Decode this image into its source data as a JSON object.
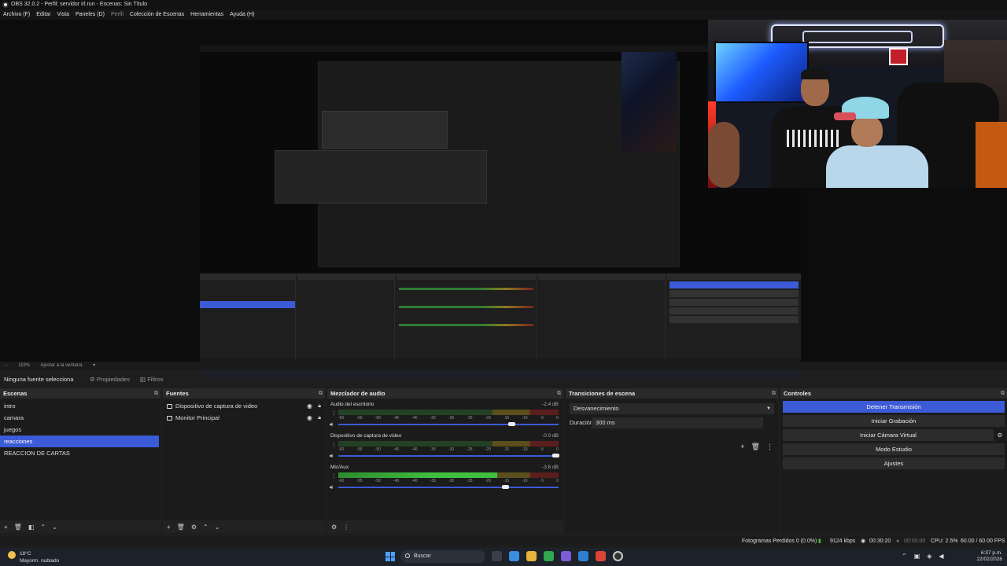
{
  "window": {
    "title": "OBS 32.0.2 - Perfil: servidor irl.run - Escenas: Sin Título"
  },
  "menu": [
    "Archivo (F)",
    "Editar",
    "Vista",
    "Paneles (D)",
    "Perfil",
    "Colección de Escenas",
    "Herramientas",
    "Ayuda (H)"
  ],
  "menu_dim_index": 4,
  "preview": {
    "zoom": "119%",
    "fit_label": "Ajustar a la ventana"
  },
  "propbar": {
    "no_source": "Ninguna fuente selecciona",
    "properties": "Propiedades",
    "filters": "Filtros"
  },
  "scenes": {
    "title": "Escenas",
    "items": [
      "intro",
      "camara",
      "juegos",
      "reacciones",
      "REACCION DE CARTAS"
    ],
    "selected_index": 3
  },
  "sources": {
    "title": "Fuentes",
    "items": [
      "Dispositivo de captura de video",
      "Monitor Principal"
    ]
  },
  "mixer": {
    "title": "Mezclador de audio",
    "ticks": [
      "-60",
      "-55",
      "-50",
      "-45",
      "-40",
      "-35",
      "-30",
      "-25",
      "-20",
      "-15",
      "-10",
      "-5",
      "0"
    ],
    "channels": [
      {
        "name": "Audio del escritorio",
        "db": "-2.4 dB",
        "level": 0,
        "volume": 0.79
      },
      {
        "name": "Dispositivo de captura de video",
        "db": "-0.0 dB",
        "level": 0,
        "volume": 0.99
      },
      {
        "name": "Mic/Aux",
        "db": "-3.6 dB",
        "level": 0.72,
        "volume": 0.76
      }
    ]
  },
  "transitions": {
    "title": "Transiciones de escena",
    "selected": "Desvanecimiento",
    "duration_label": "Duración",
    "duration_value": "300 ms"
  },
  "controls": {
    "title": "Controles",
    "buttons": [
      "Detener Transmisión",
      "Iniciar Grabación",
      "Iniciar Cámara Virtual",
      "Modo Estudio",
      "Ajustes"
    ]
  },
  "status": {
    "dropped": "Fotogramas Perdidos 0 (0.0%)",
    "bitrate": "9124 kbps",
    "stream_time": "00:30:20",
    "rec_time": "00:00:00",
    "cpu": "CPU: 2.5%",
    "fps": "60.00 / 60.00 FPS"
  },
  "taskbar": {
    "weather_temp": "18°C",
    "weather_desc": "Mayorm. nublado",
    "search": "Buscar",
    "time": "6:37 p.m.",
    "date": "22/02/2026"
  },
  "colors": {
    "accent": "#3c5bd6",
    "meter_green": "#3fbf3f",
    "meter_yellow": "#b89a22",
    "meter_red": "#a02a2a"
  }
}
